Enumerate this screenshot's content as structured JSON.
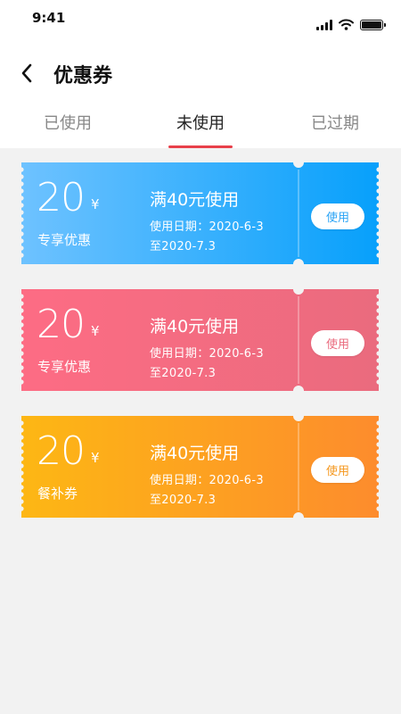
{
  "status_bar": {
    "time": "9:41"
  },
  "nav": {
    "title": "优惠券"
  },
  "tabs": [
    {
      "label": "已使用"
    },
    {
      "label": "未使用"
    },
    {
      "label": "已过期"
    }
  ],
  "coupons": [
    {
      "amount": "20",
      "currency": "¥",
      "type": "专享优惠",
      "condition": "满40元使用",
      "date_line1": "使用日期：2020-6-3",
      "date_line2": "至2020-7.3",
      "button": "使用",
      "colors": {
        "start": "#6ec2ff",
        "end": "#07a0fb",
        "button_text": "#2aa3f5"
      }
    },
    {
      "amount": "20",
      "currency": "¥",
      "type": "专享优惠",
      "condition": "满40元使用",
      "date_line1": "使用日期：2020-6-3",
      "date_line2": "至2020-7.3",
      "button": "使用",
      "colors": {
        "start": "#fd6c84",
        "end": "#ea6b7e",
        "button_text": "#ea6b7e"
      }
    },
    {
      "amount": "20",
      "currency": "¥",
      "type": "餐补券",
      "condition": "满40元使用",
      "date_line1": "使用日期：2020-6-3",
      "date_line2": "至2020-7.3",
      "button": "使用",
      "colors": {
        "start": "#fdb714",
        "end": "#fd8c2d",
        "button_text": "#f5981f"
      }
    }
  ],
  "icons": {
    "back": "chevron-left-icon",
    "signal": "signal-icon",
    "wifi": "wifi-icon",
    "battery": "battery-icon"
  },
  "accent_color": "#e8404a"
}
